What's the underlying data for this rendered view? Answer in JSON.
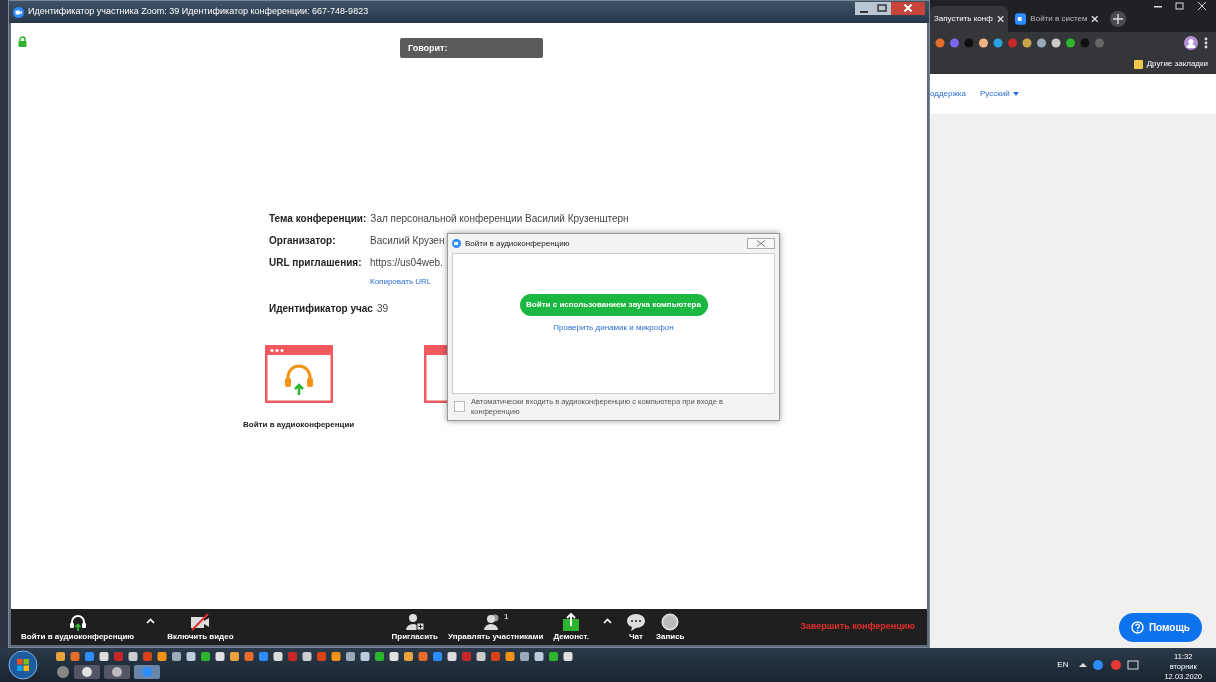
{
  "zoom_window": {
    "title": "Идентификатор участника Zoom: 39   Идентификатор конференции: 667-748-9823",
    "speaking_label": "Говорит:",
    "info": [
      {
        "label": "Тема конференции:",
        "value": "Зал персональной конференции Василий Крузенштерн"
      },
      {
        "label": "Организатор:",
        "value": "Василий Крузен"
      },
      {
        "label": "URL приглашения:",
        "value": "https://us04web.",
        "link": "Копировать URL"
      },
      {
        "label": "Идентификатор учас",
        "value": "39"
      }
    ],
    "actions": [
      {
        "label": "Войти в аудиоконференции"
      }
    ],
    "toolbar_left": [
      {
        "kind": "audio",
        "label": "Войти в аудиоконференцию",
        "menu": true
      },
      {
        "kind": "video",
        "label": "Включить видео",
        "menu": false
      }
    ],
    "toolbar_center": [
      {
        "kind": "invite",
        "label": "Пригласить",
        "menu": false
      },
      {
        "kind": "participants",
        "label": "Управлять участниками",
        "count": "1",
        "menu": false
      },
      {
        "kind": "share",
        "label": "Демонст.",
        "menu": true
      },
      {
        "kind": "chat",
        "label": "Чат",
        "menu": false
      },
      {
        "kind": "record",
        "label": "Запись",
        "menu": false
      }
    ],
    "end_button": "Завершить конференцию"
  },
  "audio_dialog": {
    "title": "Войти в аудиоконференцию",
    "join_button": "Войти с использованием звука компьютера",
    "test_link": "Проверить динамик и микрофон",
    "auto_join": {
      "label": "Автоматически входить в аудиоконференцию с компьютера при входе в конференцию",
      "checked": false
    }
  },
  "browser": {
    "tabs": [
      {
        "label": "Запустить конф",
        "selected": true
      },
      {
        "label": "Войти в систем",
        "selected": false
      }
    ],
    "bookmarks_folder": "Другие закладки",
    "nav_links": [
      {
        "label": "оддержка",
        "menu": false
      },
      {
        "label": "Русский",
        "menu": true
      }
    ],
    "help_button": "Помощь"
  },
  "taskbar": {
    "language": "EN",
    "time": "11:32",
    "weekday": "вторник",
    "date": "12.03.2020"
  }
}
